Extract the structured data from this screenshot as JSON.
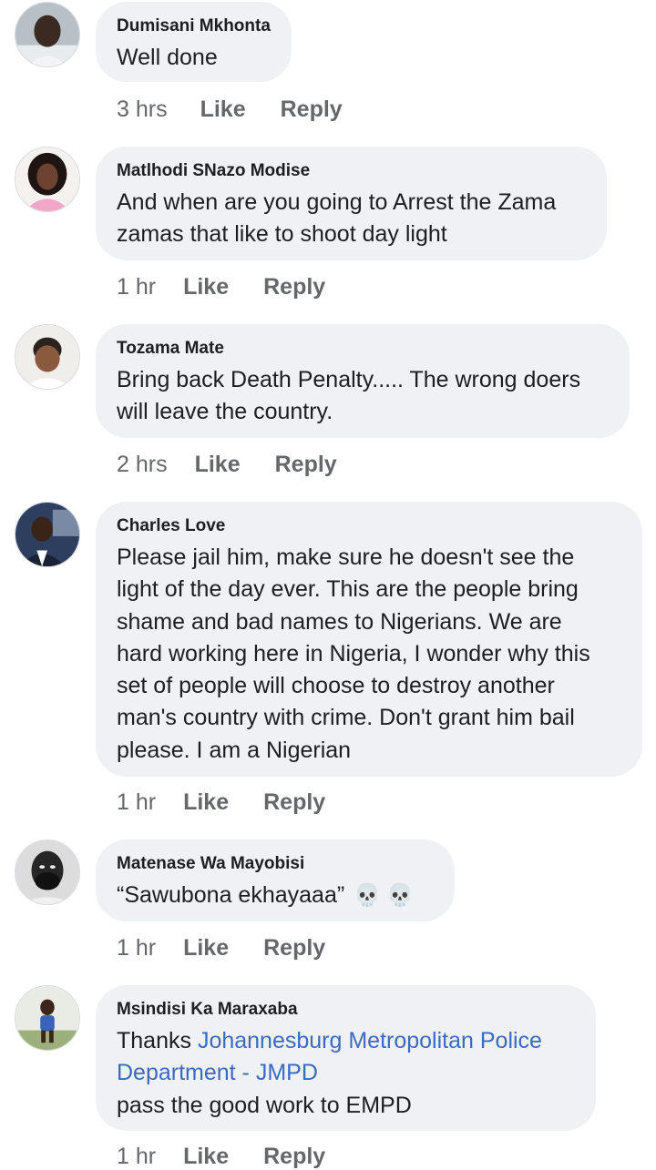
{
  "comments": [
    {
      "author": "Dumisani Mkhonta",
      "text": "Well done",
      "time": "3 hrs",
      "like": "Like",
      "reply": "Reply"
    },
    {
      "author": "Matlhodi SNazo Modise",
      "text_line1": "And when are you going to Arrest the Zama",
      "text_line2": "zamas that like to shoot day light",
      "time": "1 hr",
      "like": "Like",
      "reply": "Reply"
    },
    {
      "author": "Tozama Mate",
      "text_line1": "Bring back Death Penalty..... The wrong doers",
      "text_line2": "will leave the country.",
      "time": "2 hrs",
      "like": "Like",
      "reply": "Reply"
    },
    {
      "author": "Charles Love",
      "text_lines": [
        "Please jail him, make sure he doesn't see the",
        "light of the day ever. This are the people bring",
        "shame and bad names to Nigerians. We are",
        "hard working here in Nigeria, I wonder why this",
        "set of people will choose to destroy another",
        "man's country with crime. Don't grant him bail",
        "please. I am a Nigerian"
      ],
      "time": "1 hr",
      "like": "Like",
      "reply": "Reply"
    },
    {
      "author": "Matenase Wa Mayobisi",
      "text": "“Sawubona ekhayaaa”",
      "emoji": "skull-emoji",
      "time": "1 hr",
      "like": "Like",
      "reply": "Reply"
    },
    {
      "author": "Msindisi Ka Maraxaba",
      "text_prefix": "Thanks ",
      "mention_line1": "Johannesburg Metropolitan Police",
      "mention_line2": "Department - JMPD",
      "text_suffix": "pass the good work to EMPD",
      "time": "1 hr",
      "like": "Like",
      "reply": "Reply"
    }
  ],
  "colors": {
    "bubble": "#eff1f4",
    "text": "#1c1e21",
    "meta": "#65676b",
    "link": "#3b6ac4"
  }
}
